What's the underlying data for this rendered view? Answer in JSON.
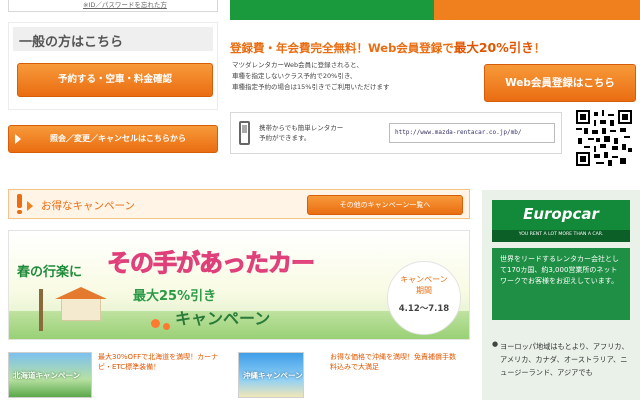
{
  "left_top": {
    "id_link": "※ID／パスワードを忘れた方"
  },
  "general": {
    "title": "一般の方はこちら",
    "reserve_button": "予約する・空車・料金確認"
  },
  "inquiry": {
    "button": "照会／変更／キャンセルはこちらから"
  },
  "member": {
    "headline_prefix": "登録費・年会費完全無料！Web会員登録で",
    "headline_highlight": "最大20%引き",
    "headline_suffix": "！",
    "text1": "マツダレンタカーWeb会員に登録されると、",
    "text2": "車種を指定しないクラス予約で20%引き、",
    "text3": "車種指定予約の場合は15%引きでご利用いただけます",
    "button": "Web会員登録はこちら"
  },
  "mobile": {
    "text1": "携帯からでも簡単レンタカー",
    "text2": "予約ができます。",
    "url": "http://www.mazda-rentacar.co.jp/mb/"
  },
  "campaign": {
    "title": "お得なキャンペーン",
    "list_button": "その他のキャンペーン一覧へ",
    "banner_spring": "春の行楽に",
    "banner_main": "その手があったカー",
    "banner_discount": "最大25%引き",
    "banner_sub": "キャンペーン",
    "period_label1": "キャンペーン",
    "period_label2": "期間",
    "period": "4.12～7.18"
  },
  "promos": [
    {
      "thumb": "北海道キャンペーン",
      "text": "最大30%OFFで北海道を満喫！カーナビ・ETC標準装備！"
    },
    {
      "thumb": "沖縄キャンペーン",
      "text": "お得な価格で沖縄を満喫！免責補償手数料込みで大満足"
    }
  ],
  "europcar": {
    "logo": "Europcar",
    "tagline": "YOU RENT A LOT MORE THAN A CAR.",
    "text": "世界をリードするレンタカー会社として170カ国、約3,000営業所のネットワークでお客様をお迎えしています。",
    "regions": "ヨーロッパ地域はもとより、アフリカ、アメリカ、カナダ、オーストラリア、ニュージーランド、アジアでも"
  },
  "colors": {
    "accent": "#f07f1e",
    "green": "#1a9a3c",
    "europcar_green": "#13893a"
  }
}
